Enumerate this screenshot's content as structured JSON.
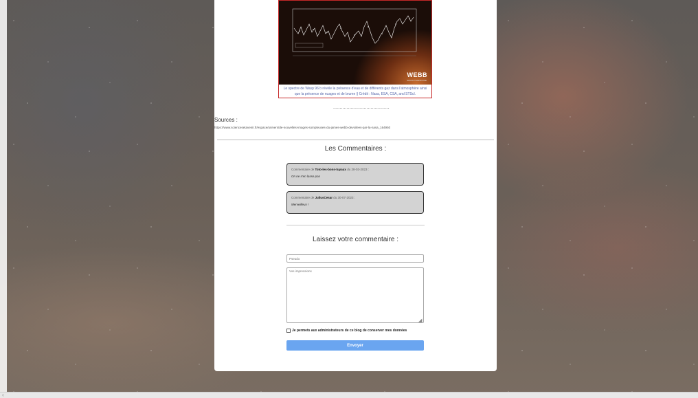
{
  "figure": {
    "logo": "WEBB",
    "logo_sub": "SPACE TELESCOPE",
    "caption": "Le spectre de Wasp 96 b révèle la présence d'eau et de différents gaz dans l'atmosphère ainsi que la présence de nuages et de brume || Crédit : Nasa, ESA, CSA, and STScI."
  },
  "separator": "..........................................",
  "sources": {
    "title": "Sources :",
    "link": "https://www.sciencesetavenir.fr/espace/univers/de-nouvelles-images-sompteuses-du-james-webb-devoilees-par-la-nasa_164950"
  },
  "comments_section": {
    "title": "Les Commentaires :",
    "items": [
      {
        "prefix": "Commentaire de ",
        "author": "Toto-les-bons-tuyaux",
        "date_text": " du 28-03-2023 :",
        "body": "On ne s'en lasse pas"
      },
      {
        "prefix": "Commentaire de ",
        "author": "JuliusCesar",
        "date_text": " du 30-07-2023 :",
        "body": "Merveilleux !"
      }
    ]
  },
  "form": {
    "title": "Laissez votre commentaire :",
    "pseudo_placeholder": "Pseudo",
    "text_placeholder": "Vos impressions",
    "consent_label": "Je permets aux administrateurs de ce blog de conserver mes données",
    "submit_label": "Envoyer"
  },
  "colors": {
    "accent_button": "#6aa5f0",
    "figure_border": "#c62828",
    "comment_bg": "#d3d3d3"
  }
}
